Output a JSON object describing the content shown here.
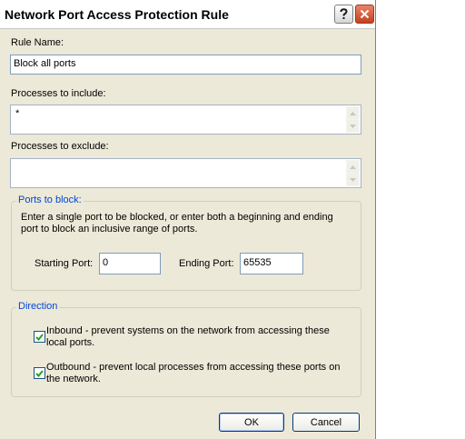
{
  "window": {
    "title": "Network Port Access Protection Rule",
    "help_icon": "question-mark-icon",
    "close_icon": "close-x-icon"
  },
  "rule_name": {
    "label": "Rule Name:",
    "value": "Block all ports"
  },
  "processes_include": {
    "label": "Processes to include:",
    "value": "*"
  },
  "processes_exclude": {
    "label": "Processes to exclude:",
    "value": ""
  },
  "ports_group": {
    "legend": "Ports to block:",
    "description": "Enter a single port to be blocked, or enter both a beginning and ending port to block an inclusive range of ports.",
    "starting_label": "Starting Port:",
    "starting_value": "0",
    "ending_label": "Ending Port:",
    "ending_value": "65535"
  },
  "direction_group": {
    "legend": "Direction",
    "inbound": {
      "label": "Inbound - prevent systems on the network from accessing these local ports.",
      "checked": true
    },
    "outbound": {
      "label": "Outbound - prevent local processes from accessing these ports on the network.",
      "checked": true
    }
  },
  "buttons": {
    "ok": "OK",
    "cancel": "Cancel"
  }
}
